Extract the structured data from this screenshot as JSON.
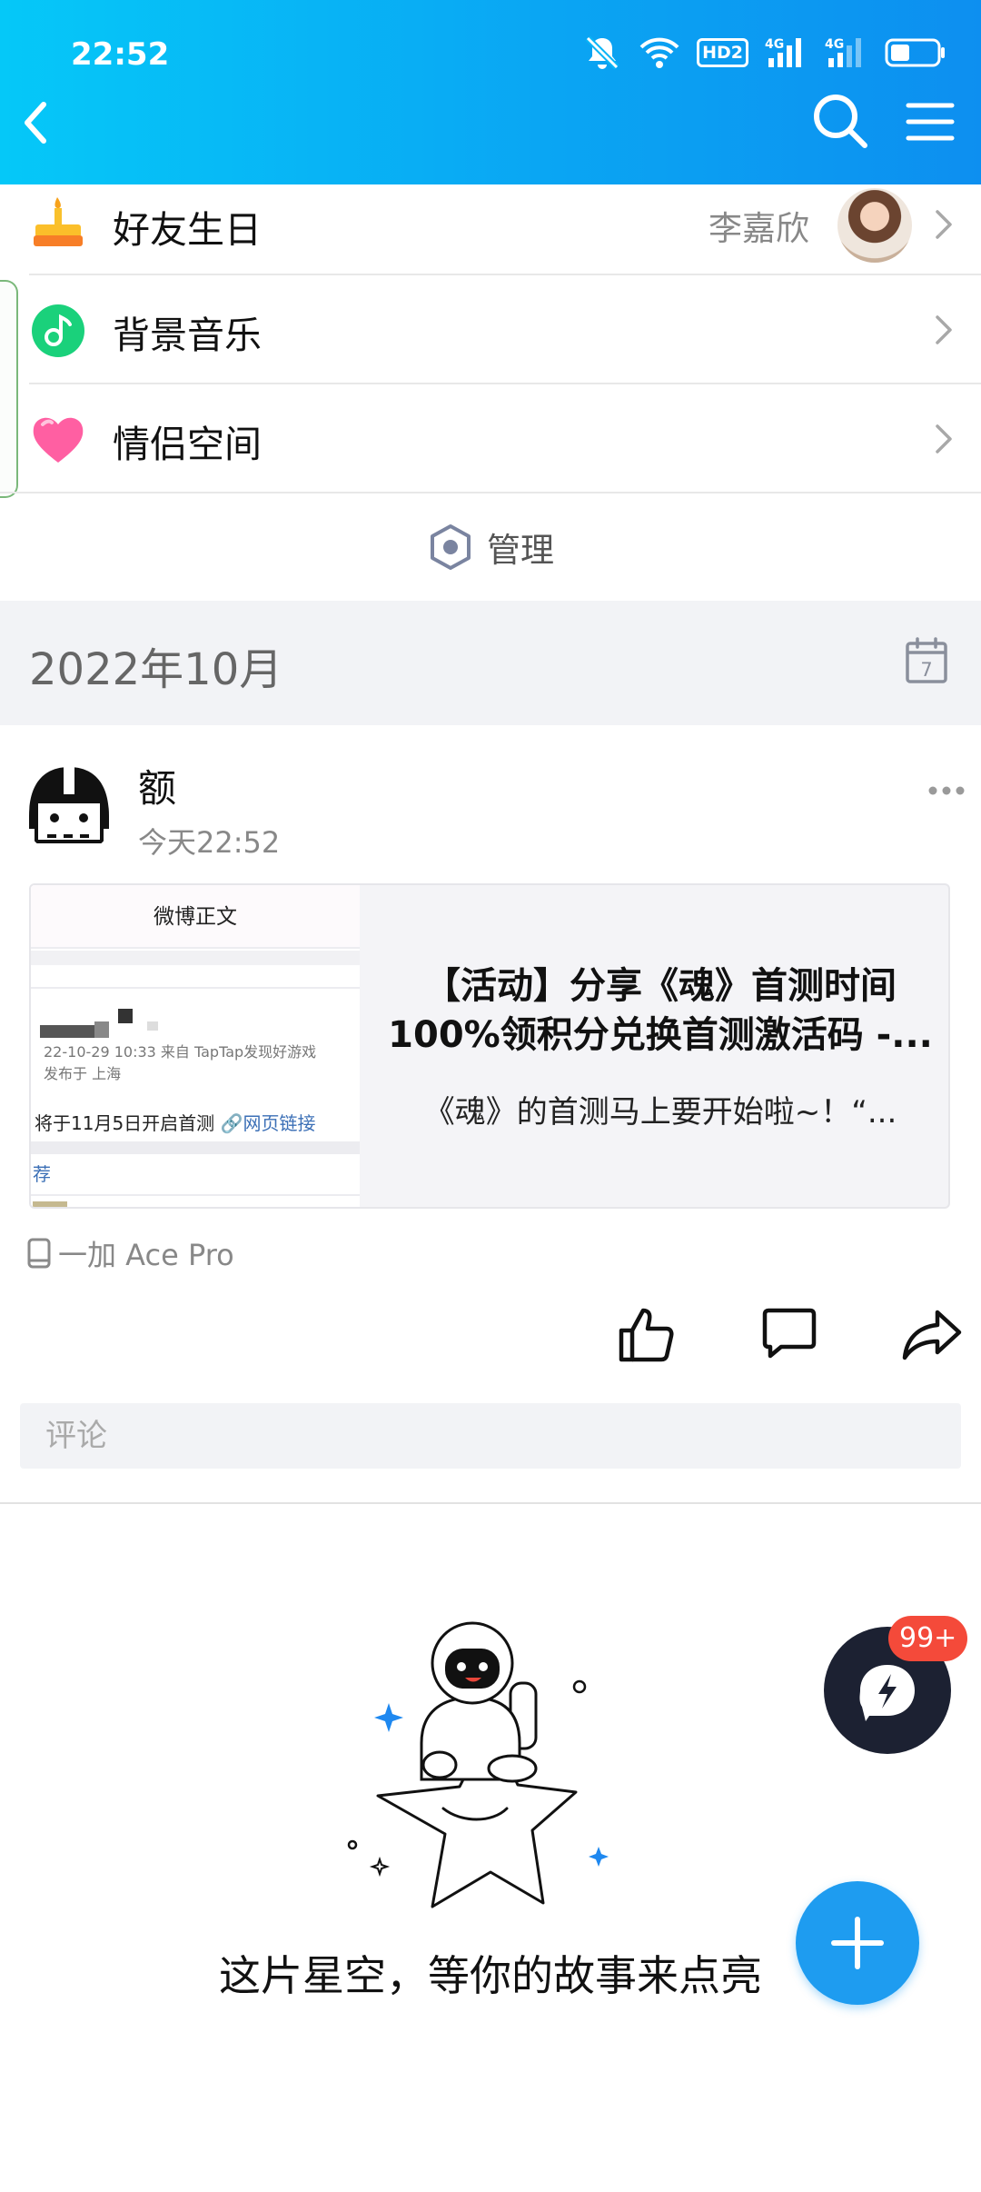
{
  "status_bar": {
    "time": "22:52",
    "hd_label": "HD2",
    "signal_label_1": "4G",
    "signal_label_2": "4G"
  },
  "header": {
    "back_icon": "back-arrow-icon",
    "search_icon": "search-icon",
    "menu_icon": "menu-icon",
    "background": "#0aa6f3"
  },
  "settings": {
    "rows": [
      {
        "icon": "birthday-cake-icon",
        "label": "好友生日",
        "value": "李嘉欣"
      },
      {
        "icon": "music-note-icon",
        "label": "背景音乐"
      },
      {
        "icon": "heart-icon",
        "label": "情侣空间"
      }
    ],
    "manage_label": "管理"
  },
  "month": {
    "label": "2022年10月",
    "calendar_day": "7"
  },
  "post": {
    "user": "额",
    "time": "今天22:52",
    "card": {
      "thumb_header": "微博正文",
      "thumb_meta_line1": "22-10-29 10:33  来自 TapTap发现好游戏",
      "thumb_meta_line2": "发布于 上海",
      "thumb_text": "将于11月5日开启首测",
      "thumb_link": "网页链接",
      "thumb_recommend": "荐",
      "title": "【活动】分享《魂》首测时间100%领积分兑换首测激活码 -...",
      "description": "《魂》的首测马上要开始啦~！“..."
    },
    "device": "一加 Ace Pro",
    "comment_placeholder": "评论"
  },
  "empty_state": {
    "text": "这片星空，等你的故事来点亮"
  },
  "fab": {
    "chat_badge": "99+",
    "accent": "#1e9cf0",
    "badge_color": "#f44a3a"
  }
}
